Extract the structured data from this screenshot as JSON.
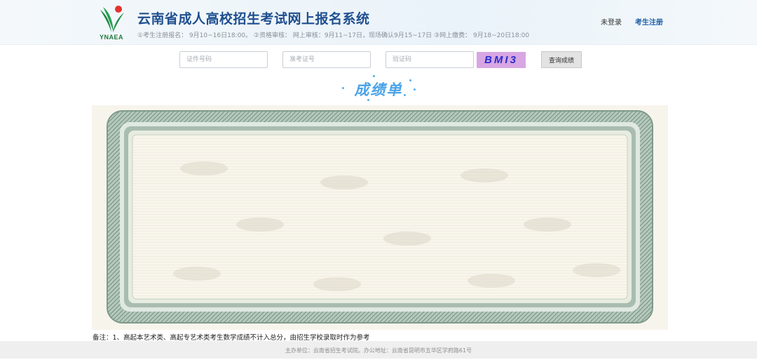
{
  "header": {
    "logo_text": "YNAEA",
    "title": "云南省成人高校招生考试网上报名系统",
    "schedule": "①考生注册报名：  9月10~16日18:00。 ②资格审核：  网上审核：9月11~17日，现场确认9月15~17日 ③网上缴费：  9月18~20日18:00",
    "login_label": "未登录",
    "register_label": "考生注册"
  },
  "query": {
    "id_placeholder": "证件号码",
    "ticket_placeholder": "准考证号",
    "captcha_placeholder": "验证码",
    "captcha_text": "BMI3",
    "submit_label": "查询成绩"
  },
  "result": {
    "title": "成绩单"
  },
  "note": "备注：1、高起本艺术类、高起专艺术类考生数学成绩不计入总分，由招生学校录取时作为参考",
  "footer": "主办单位：云南省招生考试院。办公地址：云南省昆明市五华区学府路61号",
  "colors": {
    "title_blue": "#1f4f8f",
    "captcha_bg": "#d8a6e3",
    "result_title": "#4aa3e8",
    "certificate_border": "#8aa596"
  }
}
